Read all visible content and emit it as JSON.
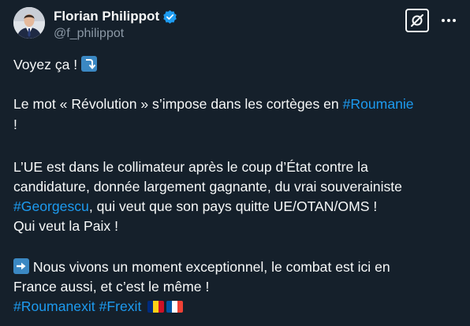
{
  "author": {
    "display_name": "Florian Philippot",
    "handle": "@f_philippot"
  },
  "icons": {
    "verified": "verified-badge-icon",
    "grok": "grok-icon",
    "more": "more-options-icon",
    "arrow_down_right": "arrow-turn-down-icon",
    "arrow_right": "arrow-right-icon",
    "flag_romania": "flag-romania-icon",
    "flag_france": "flag-france-icon"
  },
  "colors": {
    "background": "#15202b",
    "text": "#f7f9f9",
    "secondary": "#8b98a5",
    "link": "#1d9bf0",
    "verified": "#1d9bf0"
  },
  "tweet": {
    "line1": "Voyez ça ! ",
    "line2_prefix": "Le mot « Révolution » s’impose dans les cortèges en ",
    "line2_hashtag": "#Roumanie",
    "line3": "!",
    "line4": "L’UE est dans le collimateur après le coup d’État contre la",
    "line5": "candidature, donnée largement gagnante, du vrai souverainiste",
    "line6_hashtag": "#Georgescu",
    "line6_suffix": ", qui veut que son pays quitte UE/OTAN/OMS !",
    "line7": "Qui veut la Paix !",
    "line8_suffix": " Nous vivons un moment exceptionnel, le combat est ici en",
    "line9": "France aussi, et c’est le même !",
    "line10_hashtag1": "#Roumanexit",
    "line10_hashtag2": "#Frexit"
  }
}
